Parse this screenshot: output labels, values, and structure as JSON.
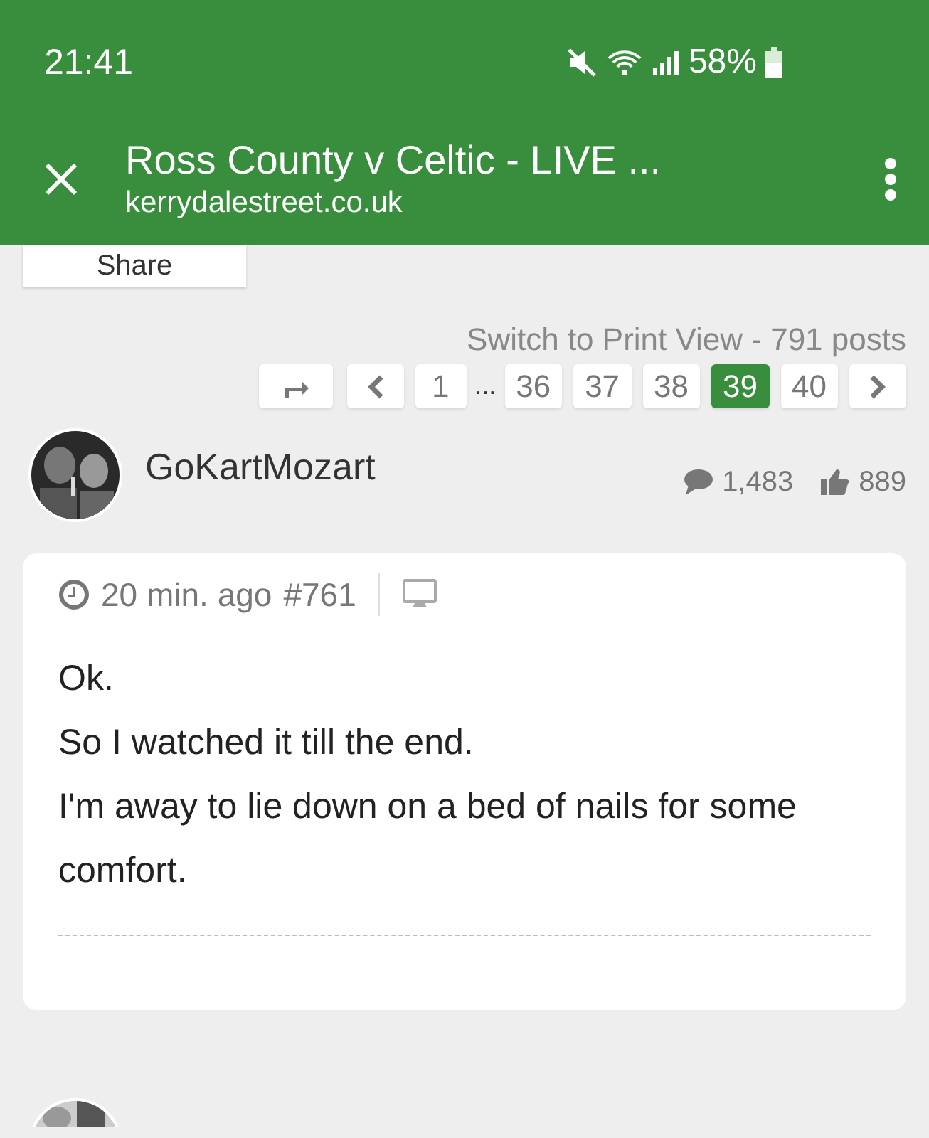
{
  "status_bar": {
    "time": "21:41",
    "battery": "58%"
  },
  "header": {
    "title": "Ross County v Celtic - LIVE ...",
    "url": "kerrydalestreet.co.uk"
  },
  "share_button": {
    "label": "Share"
  },
  "print_view_link": "Switch to Print View - 791 posts",
  "pagination": [
    {
      "kind": "jump",
      "selected": false
    },
    {
      "kind": "prev",
      "selected": false
    },
    {
      "kind": "page",
      "label": "1",
      "selected": false
    },
    {
      "kind": "ellipsis",
      "label": "..."
    },
    {
      "kind": "page",
      "label": "36",
      "selected": false
    },
    {
      "kind": "page",
      "label": "37",
      "selected": false
    },
    {
      "kind": "page",
      "label": "38",
      "selected": false
    },
    {
      "kind": "page",
      "label": "39",
      "selected": true
    },
    {
      "kind": "page",
      "label": "40",
      "selected": false
    },
    {
      "kind": "next",
      "selected": false
    }
  ],
  "post": {
    "author": "GoKartMozart",
    "comments": "1,483",
    "likes": "889",
    "time": "20 min. ago",
    "number": "#761",
    "lines": [
      "Ok.",
      "So I watched it till the end.",
      "I'm away to lie down on a bed of nails for some comfort."
    ]
  }
}
